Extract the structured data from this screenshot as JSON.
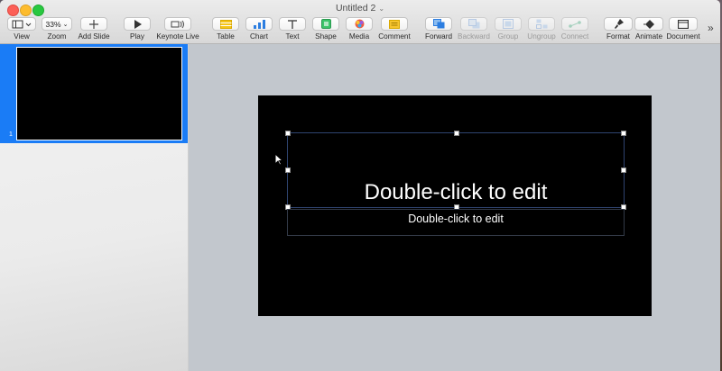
{
  "window": {
    "title": "Untitled 2"
  },
  "toolbar": {
    "items": [
      {
        "name": "view",
        "label": "View",
        "icon": "sidebar-view-icon"
      },
      {
        "name": "zoom",
        "label": "Zoom",
        "value": "33%",
        "icon": "chevron-down-icon"
      },
      {
        "name": "add-slide",
        "label": "Add Slide",
        "icon": "plus-icon"
      },
      {
        "name": "play",
        "label": "Play",
        "icon": "play-icon"
      },
      {
        "name": "keynote-live",
        "label": "Keynote Live",
        "icon": "broadcast-icon"
      },
      {
        "name": "table",
        "label": "Table",
        "icon": "table-icon"
      },
      {
        "name": "chart",
        "label": "Chart",
        "icon": "chart-icon"
      },
      {
        "name": "text",
        "label": "Text",
        "icon": "text-icon"
      },
      {
        "name": "shape",
        "label": "Shape",
        "icon": "shape-icon"
      },
      {
        "name": "media",
        "label": "Media",
        "icon": "media-icon"
      },
      {
        "name": "comment",
        "label": "Comment",
        "icon": "comment-icon"
      },
      {
        "name": "forward",
        "label": "Forward",
        "icon": "forward-icon"
      },
      {
        "name": "backward",
        "label": "Backward",
        "icon": "backward-icon",
        "disabled": true
      },
      {
        "name": "group",
        "label": "Group",
        "icon": "group-icon",
        "disabled": true
      },
      {
        "name": "ungroup",
        "label": "Ungroup",
        "icon": "ungroup-icon",
        "disabled": true
      },
      {
        "name": "connect",
        "label": "Connect",
        "icon": "connect-icon",
        "disabled": true
      },
      {
        "name": "format",
        "label": "Format",
        "icon": "paintbrush-icon"
      },
      {
        "name": "animate",
        "label": "Animate",
        "icon": "animate-icon"
      },
      {
        "name": "document",
        "label": "Document",
        "icon": "document-icon"
      }
    ],
    "overflow": "»"
  },
  "navigator": {
    "slides": [
      {
        "number": "1"
      }
    ]
  },
  "slide": {
    "title_placeholder": "Double-click to edit",
    "subtitle_placeholder": "Double-click to edit",
    "background": "#000000"
  },
  "colors": {
    "selection": "#1a7cf6",
    "canvas": "#c2c7cd"
  }
}
